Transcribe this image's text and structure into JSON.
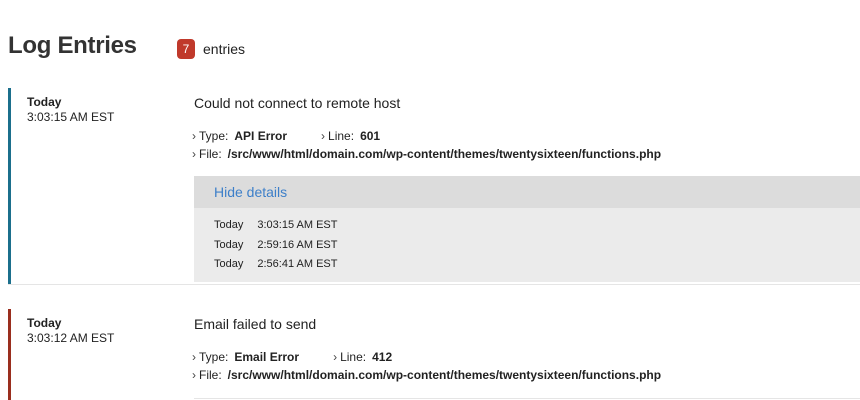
{
  "header": {
    "title": "Log Entries",
    "count": "7",
    "count_label": "entries"
  },
  "colors": {
    "badge": "#c0392b",
    "entry1_stripe": "#1b6f8c",
    "entry2_stripe": "#9a2e1e"
  },
  "entries": [
    {
      "day": "Today",
      "time": "3:03:15 AM EST",
      "message": "Could not connect to remote host",
      "type_label": "Type:",
      "type_value": "API Error",
      "line_label": "Line:",
      "line_value": "601",
      "file_label": "File:",
      "file_value": "/src/www/html/domain.com/wp-content/themes/twentysixteen/functions.php",
      "details_toggle": "Hide details",
      "occurrences": [
        {
          "day": "Today",
          "time": "3:03:15 AM EST"
        },
        {
          "day": "Today",
          "time": "2:59:16 AM EST"
        },
        {
          "day": "Today",
          "time": "2:56:41 AM EST"
        }
      ]
    },
    {
      "day": "Today",
      "time": "3:03:12 AM EST",
      "message": "Email failed to send",
      "type_label": "Type:",
      "type_value": "Email Error",
      "line_label": "Line:",
      "line_value": "412",
      "file_label": "File:",
      "file_value": "/src/www/html/domain.com/wp-content/themes/twentysixteen/functions.php"
    }
  ]
}
